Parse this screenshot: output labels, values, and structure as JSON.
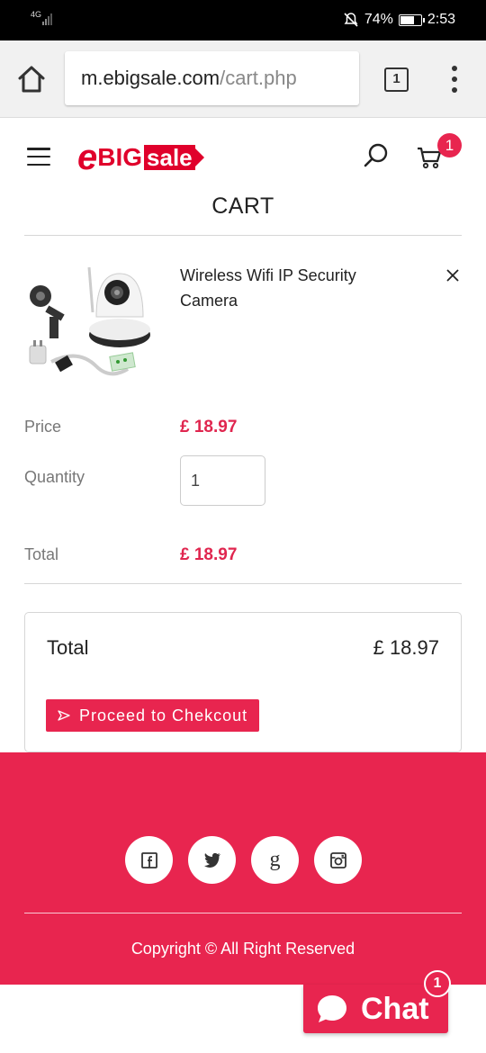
{
  "status_bar": {
    "network": "4G",
    "battery_percent": "74%",
    "battery_level": 0.74,
    "time": "2:53"
  },
  "browser": {
    "url_domain": "m.ebigsale.com",
    "url_path": "/cart.php",
    "tab_count": "1"
  },
  "header": {
    "logo_e": "e",
    "logo_big": "BIG",
    "logo_sale": "sale",
    "cart_count": "1"
  },
  "page": {
    "title": "CART"
  },
  "cart_item": {
    "name": "Wireless Wifi IP Security Camera",
    "price_label": "Price",
    "price": "£ 18.97",
    "quantity_label": "Quantity",
    "quantity": "1",
    "total_label": "Total",
    "total": "£ 18.97"
  },
  "summary": {
    "total_label": "Total",
    "total": "£ 18.97",
    "checkout_label": "Proceed to Chekcout"
  },
  "footer": {
    "social": [
      "facebook-icon",
      "twitter-icon",
      "google-icon",
      "instagram-icon"
    ],
    "google_glyph": "g",
    "copyright": "Copyright © All Right Reserved"
  },
  "chat": {
    "label": "Chat",
    "badge": "1"
  },
  "colors": {
    "accent": "#e8254f",
    "logo_red": "#e0002b",
    "price": "#e0264f"
  }
}
